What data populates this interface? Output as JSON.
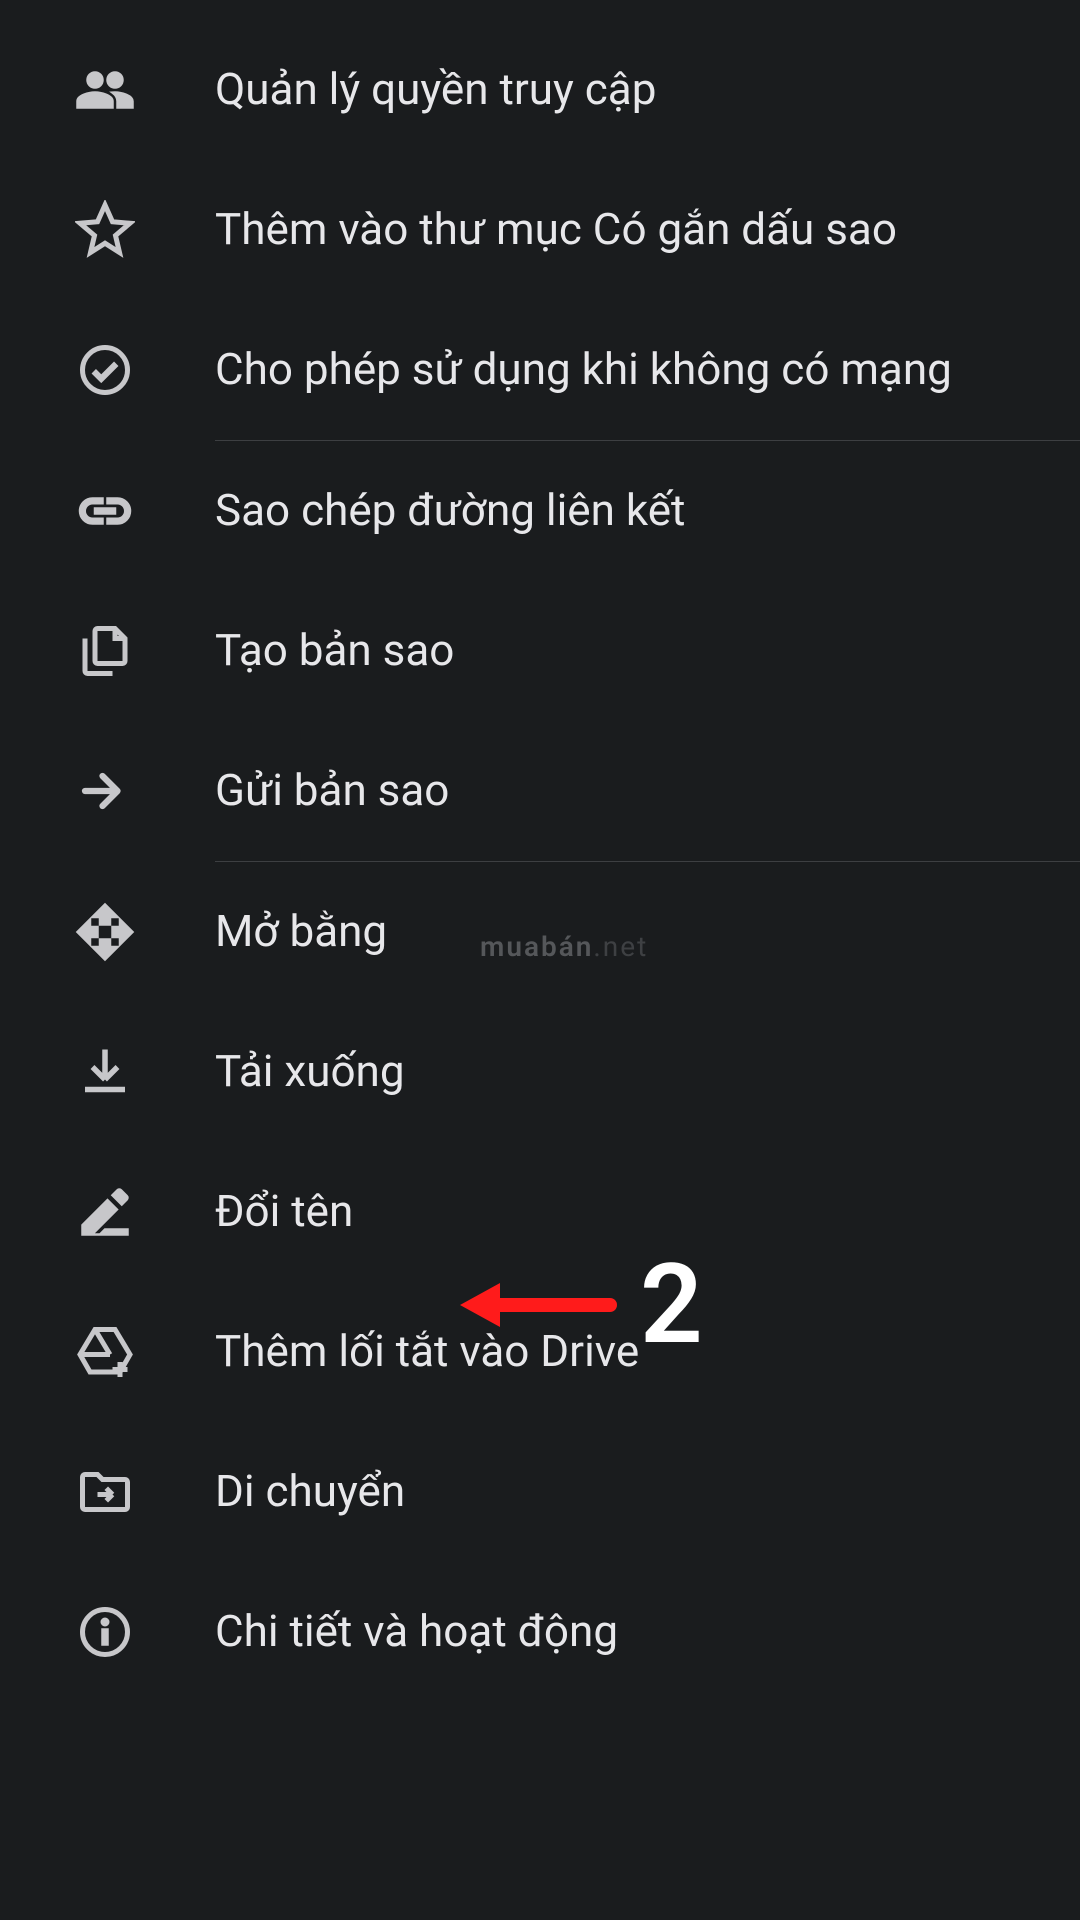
{
  "menu": {
    "items": [
      {
        "id": "manage-access",
        "icon": "people-icon",
        "label": "Quản lý quyền truy cập"
      },
      {
        "id": "add-starred",
        "icon": "star-icon",
        "label": "Thêm vào thư mục Có gắn dấu sao"
      },
      {
        "id": "offline",
        "icon": "offline-icon",
        "label": "Cho phép sử dụng khi không có mạng",
        "divider_after": true
      },
      {
        "id": "copy-link",
        "icon": "link-icon",
        "label": "Sao chép đường liên kết"
      },
      {
        "id": "make-copy",
        "icon": "copy-icon",
        "label": "Tạo bản sao"
      },
      {
        "id": "send-copy",
        "icon": "send-icon",
        "label": "Gửi bản sao",
        "divider_after": true
      },
      {
        "id": "open-with",
        "icon": "open-with-icon",
        "label": "Mở bằng"
      },
      {
        "id": "download",
        "icon": "download-icon",
        "label": "Tải xuống"
      },
      {
        "id": "rename",
        "icon": "rename-icon",
        "label": "Đổi tên"
      },
      {
        "id": "add-shortcut",
        "icon": "shortcut-icon",
        "label": "Thêm lối tắt vào Drive"
      },
      {
        "id": "move",
        "icon": "move-icon",
        "label": "Di chuyển"
      },
      {
        "id": "details",
        "icon": "info-icon",
        "label": "Chi tiết và hoạt động"
      }
    ]
  },
  "watermark": {
    "main": "muabán",
    "suffix": ".net"
  },
  "annotation": {
    "number": "2",
    "target": "download",
    "color": "#ff1b1b"
  }
}
